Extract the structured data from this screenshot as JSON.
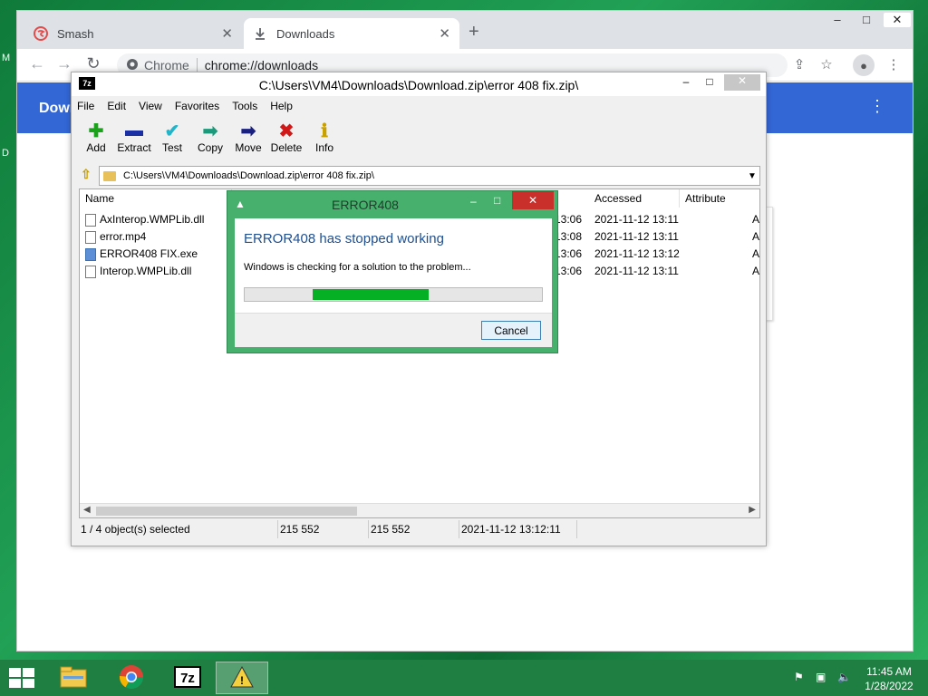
{
  "desktop": {
    "edge_labels": [
      "M",
      "D"
    ]
  },
  "chrome": {
    "tabs": [
      {
        "label": "Smash",
        "active": false
      },
      {
        "label": "Downloads",
        "active": true
      }
    ],
    "new_tab": "+",
    "window_controls": {
      "minimize": "–",
      "maximize": "□",
      "close": "✕"
    },
    "address": {
      "chip": "Chrome",
      "url": "chrome://downloads"
    },
    "downloads_header": {
      "title": "Down",
      "menu": "⋮"
    }
  },
  "sevenzip": {
    "title": "C:\\Users\\VM4\\Downloads\\Download.zip\\error 408 fix.zip\\",
    "logo": "7z",
    "menu": [
      "File",
      "Edit",
      "View",
      "Favorites",
      "Tools",
      "Help"
    ],
    "toolbar": [
      {
        "label": "Add",
        "icon": "plus-icon",
        "glyph": "✚",
        "color": "#1aa31a"
      },
      {
        "label": "Extract",
        "icon": "minus-icon",
        "glyph": "▬",
        "color": "#1a2fa3"
      },
      {
        "label": "Test",
        "icon": "check-icon",
        "glyph": "✔",
        "color": "#22b5c9"
      },
      {
        "label": "Copy",
        "icon": "copy-arrow-icon",
        "glyph": "➡",
        "color": "#1a9a7a"
      },
      {
        "label": "Move",
        "icon": "move-arrow-icon",
        "glyph": "➡",
        "color": "#1a2080"
      },
      {
        "label": "Delete",
        "icon": "delete-x-icon",
        "glyph": "✖",
        "color": "#d01818"
      },
      {
        "label": "Info",
        "icon": "info-icon",
        "glyph": "ℹ",
        "color": "#c8a000"
      }
    ],
    "path": "C:\\Users\\VM4\\Downloads\\Download.zip\\error 408 fix.zip\\",
    "columns": [
      "Name",
      "Accessed",
      "Attribute"
    ],
    "files": [
      {
        "name": "AxInterop.WMPLib.dll",
        "modified_tail": "13:06",
        "accessed": "2021-11-12 13:11",
        "attr": "A"
      },
      {
        "name": "error.mp4",
        "modified_tail": "13:08",
        "accessed": "2021-11-12 13:11",
        "attr": "A"
      },
      {
        "name": "ERROR408 FIX.exe",
        "modified_tail": "13:06",
        "accessed": "2021-11-12 13:12",
        "attr": "A"
      },
      {
        "name": "Interop.WMPLib.dll",
        "modified_tail": "13:06",
        "accessed": "2021-11-12 13:11",
        "attr": "A"
      }
    ],
    "status": {
      "selected": "1 / 4 object(s) selected",
      "size": "215 552",
      "packed": "215 552",
      "date": "2021-11-12 13:12:11"
    }
  },
  "error_dialog": {
    "title": "ERROR408",
    "heading": "ERROR408 has stopped working",
    "message": "Windows is checking for a solution to the problem...",
    "progress_start": 0.23,
    "progress_end": 0.62,
    "cancel_label": "Cancel"
  },
  "taskbar": {
    "time": "11:45 AM",
    "date": "1/28/2022"
  }
}
